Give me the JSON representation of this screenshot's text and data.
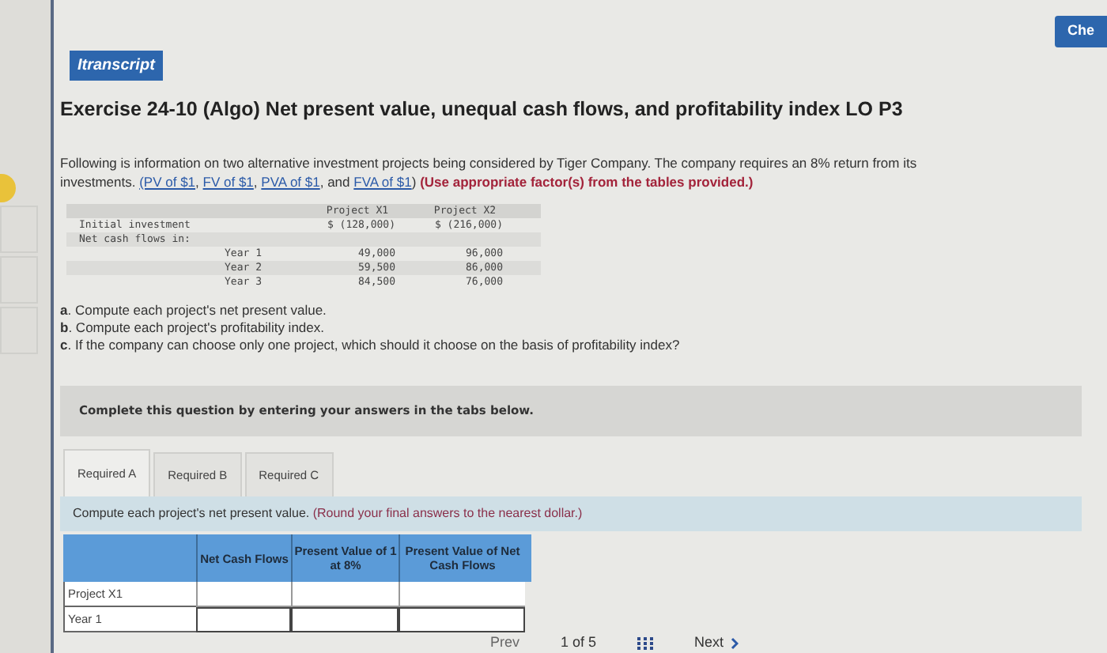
{
  "header_button": "Itranscript",
  "corner_button": "Che",
  "title": "Exercise 24-10 (Algo) Net present value, unequal cash flows, and profitability index LO P3",
  "intro": [
    {
      "kind": "text",
      "text": "Following is information on two alternative investment projects being considered by Tiger Company. The company requires an 8% return from its investments."
    },
    {
      "kind": "link",
      "text": "(PV of $1"
    },
    {
      "kind": "text",
      "text": ","
    },
    {
      "kind": "link",
      "text": "FV of $1"
    },
    {
      "kind": "text",
      "text": ","
    },
    {
      "kind": "link",
      "text": "PVA of $1"
    },
    {
      "kind": "text",
      "text": ", and"
    },
    {
      "kind": "link",
      "text": "FVA of $1"
    },
    {
      "kind": "text",
      "text": ")"
    },
    {
      "kind": "note",
      "text": "(Use appropriate factor(s) from the tables provided.)"
    }
  ],
  "data_table": {
    "columns": [
      "Project X1",
      "Project X2"
    ],
    "rows": [
      {
        "label": "Initial investment",
        "kind": "main",
        "values": [
          "$ (128,000)",
          "$ (216,000)"
        ]
      },
      {
        "label": "Net cash flows in:",
        "kind": "main",
        "values": []
      },
      {
        "label": "Year 1",
        "kind": "year",
        "values": [
          "49,000",
          "96,000"
        ]
      },
      {
        "label": "Year 2",
        "kind": "year",
        "values": [
          "59,500",
          "86,000"
        ]
      },
      {
        "label": "Year 3",
        "kind": "year",
        "values": [
          "84,500",
          "76,000"
        ]
      }
    ]
  },
  "questions": [
    {
      "letter": "a",
      "text": ". Compute each project's net present value."
    },
    {
      "letter": "b",
      "text": ". Compute each project's profitability index."
    },
    {
      "letter": "c",
      "text": ". If the company can choose only one project, which should it choose on the basis of profitability index?"
    }
  ],
  "banner": "Complete this question by entering your answers in the tabs below.",
  "tabs": [
    {
      "label": "Required A",
      "selected": true
    },
    {
      "label": "Required B",
      "selected": false
    },
    {
      "label": "Required C",
      "selected": false
    }
  ],
  "instruction": {
    "text": "Compute each project's net present value.",
    "note": "(Round your final answers to the nearest dollar.)"
  },
  "answer_table": {
    "columns": [
      "Net Cash Flows",
      "Present Value of 1 at 8%",
      "Present Value of Net Cash Flows"
    ],
    "rows": [
      {
        "label": "Project X1",
        "kind": "heading"
      },
      {
        "label": "Year 1",
        "kind": "input"
      }
    ]
  },
  "nav": {
    "prev": "Prev",
    "page": "1 of 5",
    "next": "Next"
  }
}
